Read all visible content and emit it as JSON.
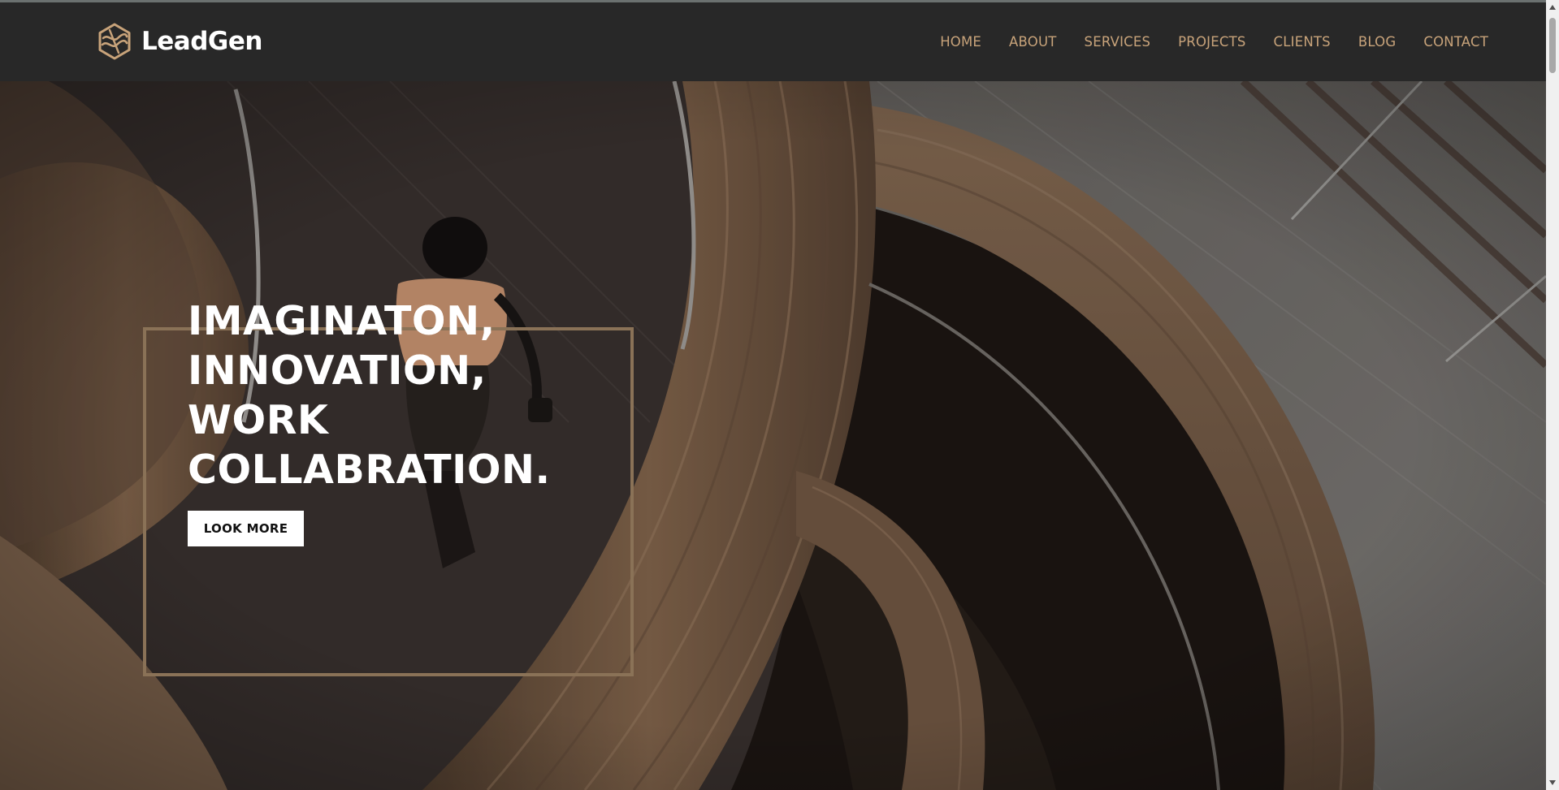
{
  "brand": {
    "name": "LeadGen",
    "logo_icon": "hexagon-waves-icon",
    "accent_color": "#c8a37a"
  },
  "nav": {
    "items": [
      {
        "label": "HOME"
      },
      {
        "label": "ABOUT"
      },
      {
        "label": "SERVICES"
      },
      {
        "label": "PROJECTS"
      },
      {
        "label": "CLIENTS"
      },
      {
        "label": "BLOG"
      },
      {
        "label": "CONTACT"
      }
    ]
  },
  "hero": {
    "headline_lines": [
      "IMAGINATON,",
      "INNOVATION,",
      "WORK",
      "COLLABRATION."
    ],
    "cta_label": "LOOK MORE",
    "frame_color": "#8a7257"
  },
  "colors": {
    "header_bg": "#282828",
    "cta_bg": "#ffffff"
  }
}
